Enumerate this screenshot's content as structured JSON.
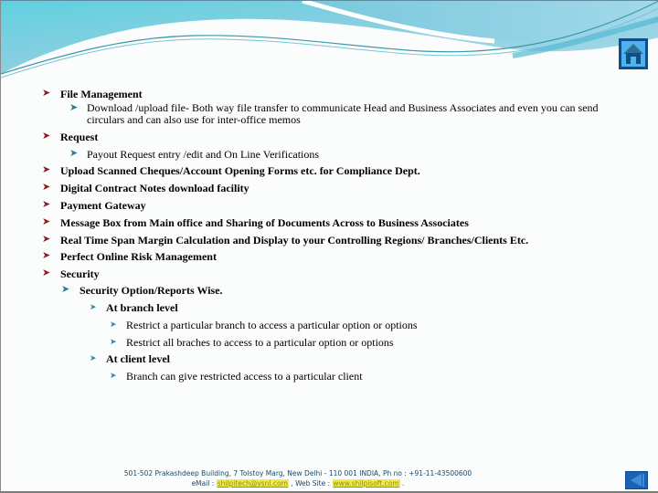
{
  "navigation": {
    "home_icon": "home-icon",
    "back_icon": "back-arrow-icon"
  },
  "colors": {
    "primary_bullet": "#8c1f2a",
    "secondary_bullet": "#2a7d96",
    "footer_text": "#174c6a",
    "link_highlight": "#f0ec4a",
    "home_button_bg": "#4fb2ec",
    "home_button_border": "#0d4e8c",
    "back_button_bg": "#1a63b4"
  },
  "features": {
    "file_management": {
      "title": "File Management",
      "sub": [
        "Download /upload file- Both way file transfer to communicate Head and Business Associates and even you can send circulars and can also use for inter-office memos"
      ]
    },
    "request": {
      "title": "Request",
      "sub": [
        "Payout Request entry /edit and On Line Verifications"
      ]
    },
    "upload": "Upload Scanned  Cheques/Account Opening Forms etc. for Compliance Dept.",
    "digital_contract": "Digital Contract Notes download facility",
    "payment_gateway": "Payment Gateway",
    "message_box": "Message Box from Main office and Sharing of Documents Across to Business Associates",
    "real_time": "Real Time Span Margin Calculation and Display to your Controlling Regions/ Branches/Clients Etc.",
    "risk_management": "Perfect Online Risk Management",
    "security": {
      "title": "Security",
      "option": "Security Option/Reports Wise.",
      "branch_level": {
        "title": "At branch level",
        "items": [
          "Restrict a particular branch to access a particular option or options",
          "Restrict all braches to  access to a particular option or options"
        ]
      },
      "client_level": {
        "title": "At client level",
        "items": [
          "Branch can give restricted access to a particular client"
        ]
      }
    }
  },
  "footer": {
    "address": "501-502 Prakashdeep Building, 7 Tolstoy Marg, New Delhi - 110 001 INDIA,  Ph no : +91-11-43500600",
    "email_label": "eMail : ",
    "email": "shilpitech@vsnl.com",
    "web_label": " , Web Site : ",
    "website": "www.shilpisoft.com",
    "trailing": " ."
  }
}
